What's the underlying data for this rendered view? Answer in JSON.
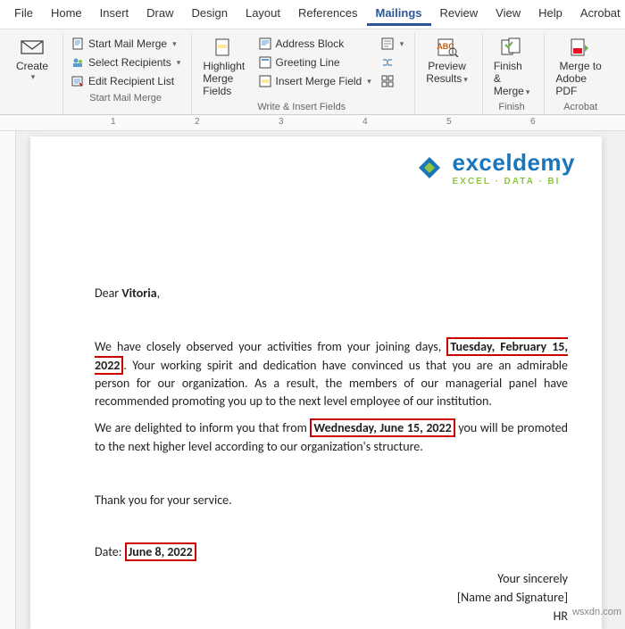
{
  "menu": {
    "file": "File",
    "home": "Home",
    "insert": "Insert",
    "draw": "Draw",
    "design": "Design",
    "layout": "Layout",
    "references": "References",
    "mailings": "Mailings",
    "review": "Review",
    "view": "View",
    "help": "Help",
    "acrobat": "Acrobat"
  },
  "ribbon": {
    "create": {
      "label": "Create",
      "group": ""
    },
    "start_group": "Start Mail Merge",
    "start_mm": "Start Mail Merge",
    "select_recip": "Select Recipients",
    "edit_recip": "Edit Recipient List",
    "highlight": {
      "l1": "Highlight",
      "l2": "Merge Fields"
    },
    "addr": "Address Block",
    "greet": "Greeting Line",
    "insert_mf": "Insert Merge Field",
    "write_group": "Write & Insert Fields",
    "preview": {
      "l1": "Preview",
      "l2": "Results"
    },
    "finish": {
      "l1": "Finish &",
      "l2": "Merge",
      "group": "Finish"
    },
    "adobe": {
      "l1": "Merge to",
      "l2": "Adobe PDF",
      "group": "Acrobat"
    }
  },
  "doc": {
    "logo_main": "exceldemy",
    "logo_sub": "EXCEL · DATA · BI",
    "dear": "Dear ",
    "name": "Vitoria",
    "comma": ",",
    "p1a": "We have closely observed your activities from your joining days, ",
    "date1": "Tuesday, February 15, 2022",
    "p1b": ". Your working spirit and dedication have convinced us that you are an admirable person for our organization. As a result, the members of our managerial panel have recommended promoting you up to the next level employee of our institution.",
    "p2a": "We are delighted to inform you that from ",
    "date2": "Wednesday, June 15, 2022",
    "p2b": " you will be promoted to the next higher level according to our organization's structure.",
    "thanks": "Thank you for your service.",
    "date_lbl": "Date: ",
    "date3": "June 8, 2022",
    "sincerely": "Your sincerely",
    "namesig": "[Name and Signature]",
    "hr": "HR"
  },
  "ruler": [
    "1",
    "2",
    "3",
    "4",
    "5",
    "6"
  ],
  "watermark": "wsxdn.com"
}
